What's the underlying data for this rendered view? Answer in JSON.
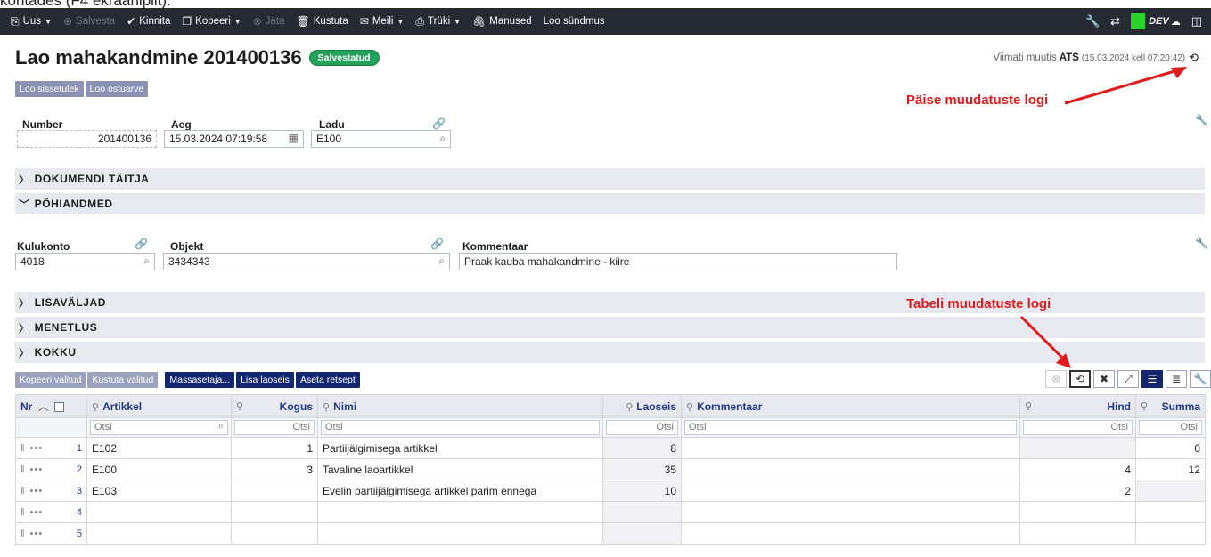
{
  "clipped_heading": "kontades (F4 ekraanipilt):",
  "toolbar": {
    "items": [
      {
        "label": "Uus",
        "icon": "new-doc-icon",
        "caret": true,
        "disabled": false
      },
      {
        "label": "Salvesta",
        "icon": "save-icon",
        "caret": false,
        "disabled": true
      },
      {
        "label": "Kinnita",
        "icon": "check-icon",
        "caret": false,
        "disabled": false
      },
      {
        "label": "Kopeeri",
        "icon": "copy-icon",
        "caret": true,
        "disabled": false
      },
      {
        "label": "Jäta",
        "icon": "cancel-icon",
        "caret": false,
        "disabled": true
      },
      {
        "label": "Kustuta",
        "icon": "trash-icon",
        "caret": false,
        "disabled": false
      },
      {
        "label": "Meili",
        "icon": "mail-icon",
        "caret": true,
        "disabled": false
      },
      {
        "label": "Trüki",
        "icon": "print-icon",
        "caret": true,
        "disabled": false
      },
      {
        "label": "Manused",
        "icon": "paperclip-icon",
        "caret": false,
        "disabled": false
      },
      {
        "label": "Loo sündmus",
        "icon": "",
        "caret": false,
        "disabled": false
      }
    ],
    "dev_label": "DEV",
    "accent_color": "#27d427"
  },
  "header": {
    "title": "Lao mahakandmine 201400136",
    "status_badge": "Salvestatud",
    "modified_prefix": "Viimati muutis",
    "modified_user": "ATS",
    "modified_time": "(15.03.2024 kell 07:20:42)",
    "buttons": [
      "Loo sissetulek",
      "Loo ostuarve"
    ]
  },
  "annotations": {
    "header_log": "Päise muudatuste logi",
    "table_log": "Tabeli muudatuste logi"
  },
  "fields_top": {
    "number_label": "Number",
    "number_value": "201400136",
    "aeg_label": "Aeg",
    "aeg_value": "15.03.2024 07:19:58",
    "ladu_label": "Ladu",
    "ladu_value": "E100"
  },
  "sections": {
    "s1": "DOKUMENDI TÄITJA",
    "s2": "PÕHIANDMED",
    "s3": "LISAVÄLJAD",
    "s4": "MENETLUS",
    "s5": "KOKKU"
  },
  "fields_main": {
    "kulukonto_label": "Kulukonto",
    "kulukonto_value": "4018",
    "objekt_label": "Objekt",
    "objekt_value": "3434343",
    "kommentaar_label": "Kommentaar",
    "kommentaar_value": "Praak kauba mahakandmine - kiire"
  },
  "table_buttons": [
    "Kopeeri valitud",
    "Kustuta valitud",
    "Massasetaja...",
    "Lisa laoseis",
    "Aseta retsept"
  ],
  "table": {
    "headers": {
      "nr": "Nr",
      "artikkel": "Artikkel",
      "kogus": "Kogus",
      "nimi": "Nimi",
      "laoseis": "Laoseis",
      "kommentaar": "Kommentaar",
      "hind": "Hind",
      "summa": "Summa"
    },
    "filter_placeholder": "Otsi",
    "rows": [
      {
        "nr": "1",
        "artikkel": "E102",
        "kogus": "1",
        "nimi": "Partiijälgimisega artikkel",
        "laoseis": "8",
        "kommentaar": "",
        "hind": "",
        "summa": "0"
      },
      {
        "nr": "2",
        "artikkel": "E100",
        "kogus": "3",
        "nimi": "Tavaline laoartikkel",
        "laoseis": "35",
        "kommentaar": "",
        "hind": "4",
        "summa": "12"
      },
      {
        "nr": "3",
        "artikkel": "E103",
        "kogus": "",
        "nimi": "Evelin partiijälgimisega artikkel parim ennega",
        "laoseis": "10",
        "kommentaar": "",
        "hind": "2",
        "summa": ""
      },
      {
        "nr": "4",
        "artikkel": "",
        "kogus": "",
        "nimi": "",
        "laoseis": "",
        "kommentaar": "",
        "hind": "",
        "summa": ""
      },
      {
        "nr": "5",
        "artikkel": "",
        "kogus": "",
        "nimi": "",
        "laoseis": "",
        "kommentaar": "",
        "hind": "",
        "summa": ""
      }
    ]
  }
}
